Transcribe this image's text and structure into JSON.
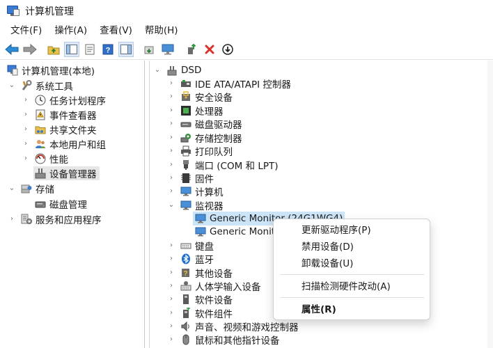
{
  "window": {
    "title": "计算机管理"
  },
  "menubar": {
    "items": [
      "文件(F)",
      "操作(A)",
      "查看(V)",
      "帮助(H)"
    ]
  },
  "toolbar": {
    "icons": [
      "back-arrow-icon",
      "forward-arrow-icon",
      "up-folder-icon",
      "show-hide-tree-icon",
      "properties-icon",
      "help-icon",
      "show-action-pane-icon",
      "scan-hardware-icon",
      "monitor-icon",
      "update-driver-icon",
      "uninstall-icon",
      "disable-device-icon"
    ]
  },
  "left_tree": {
    "root": "计算机管理(本地)",
    "system_tools": "系统工具",
    "task_scheduler": "任务计划程序",
    "event_viewer": "事件查看器",
    "shared_folders": "共享文件夹",
    "local_users": "本地用户和组",
    "performance": "性能",
    "device_manager": "设备管理器",
    "storage": "存储",
    "disk_management": "磁盘管理",
    "services": "服务和应用程序"
  },
  "device_tree": {
    "computer": "DSD",
    "categories": {
      "ide": "IDE ATA/ATAPI 控制器",
      "security": "安全设备",
      "processors": "处理器",
      "disk_drives": "磁盘驱动器",
      "storage_controllers": "存储控制器",
      "print_queues": "打印队列",
      "ports": "端口 (COM 和 LPT)",
      "firmware": "固件",
      "computer": "计算机",
      "monitors": "监视器",
      "keyboards": "键盘",
      "bluetooth": "蓝牙",
      "other_devices": "其他设备",
      "hid": "人体学输入设备",
      "software_devices": "软件设备",
      "software_components": "软件组件",
      "sound": "声音、视频和游戏控制器",
      "mice": "鼠标和其他指针设备"
    },
    "monitors": {
      "item1": "Generic Monitor (24G1WG4)",
      "item2": "Generic Monitor"
    }
  },
  "context_menu": {
    "update_driver": "更新驱动程序(P)",
    "disable_device": "禁用设备(D)",
    "uninstall_device": "卸载设备(U)",
    "scan_hardware": "扫描检测硬件改动(A)",
    "properties": "属性(R)"
  },
  "colors": {
    "selection_highlight": "#cce4f7",
    "selected_gray": "#e6e6e6",
    "accent_blue": "#2b79d0",
    "delete_red": "#d9302b"
  }
}
